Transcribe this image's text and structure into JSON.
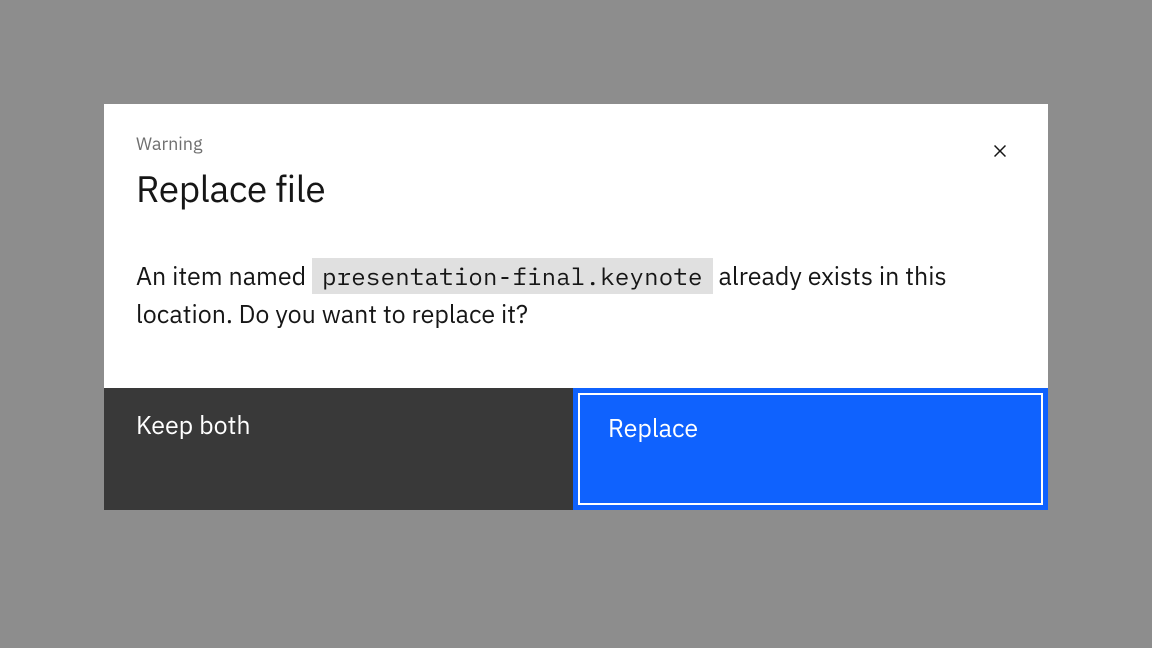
{
  "modal": {
    "label": "Warning",
    "title": "Replace file",
    "body_prefix": "An item named ",
    "filename": "presentation-final.keynote",
    "body_suffix": " already exists in this location. Do you want to replace it?",
    "buttons": {
      "secondary": "Keep both",
      "primary": "Replace"
    }
  }
}
